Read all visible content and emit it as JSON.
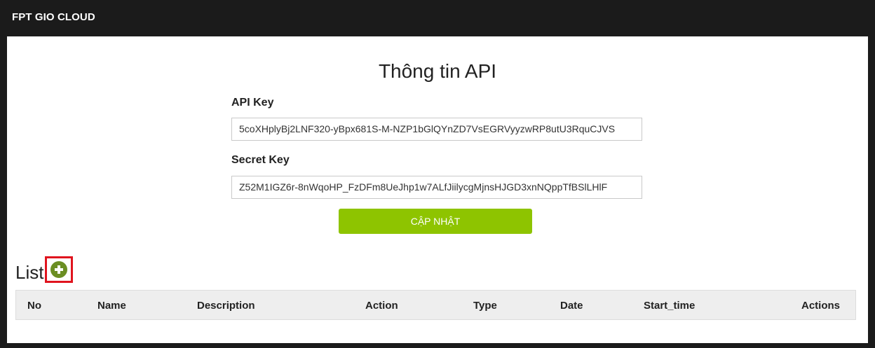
{
  "app": {
    "brand": "FPT GIO CLOUD"
  },
  "api_info": {
    "title": "Thông tin API",
    "api_key_label": "API Key",
    "api_key_value": "5coXHplyBj2LNF320-yBpx681S-M-NZP1bGlQYnZD7VsEGRVyyzwRP8utU3RquCJVS",
    "secret_key_label": "Secret Key",
    "secret_key_value": "Z52M1IGZ6r-8nWqoHP_FzDFm8UeJhp1w7ALfJiilycgMjnsHJGD3xnNQppTfBSlLHlF",
    "update_button": "CẬP NHẬT"
  },
  "list": {
    "title": "List",
    "add_icon": "plus-circle-icon",
    "columns": [
      "No",
      "Name",
      "Description",
      "Action",
      "Type",
      "Date",
      "Start_time",
      "Actions"
    ]
  },
  "colors": {
    "topbar": "#1b1b1b",
    "button": "#8ec400",
    "add_icon": "#6b8e23",
    "highlight": "#e0141e"
  }
}
